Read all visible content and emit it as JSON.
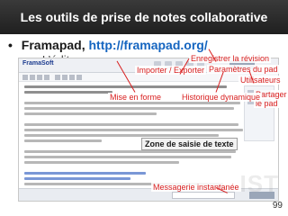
{
  "slide": {
    "title": "Les outils de prise de notes collaborative",
    "bullet_symbol": "•",
    "bullet_label": "Framapad,",
    "bullet_url": "http://framapad.org/",
    "sub_bullet": "– L’éditeur",
    "page_number": "99"
  },
  "pad": {
    "logo_text": "FramaSoft"
  },
  "callouts": {
    "importer_exporter": "Importer / Exporter",
    "enregistrer_revision": "Enregistrer la révision",
    "parametres_pad": "Paramètres du pad",
    "utilisateurs": "Utilisateurs",
    "partager_line1": "Partager",
    "partager_line2": "le pad",
    "mise_en_forme": "Mise en forme",
    "historique_dynamique": "Historique dynamique",
    "zone_saisie": "Zone de saisie de texte",
    "messagerie": "Messagerie instantanée"
  },
  "colors": {
    "title_bar": "#2a2a2a",
    "callout_text": "#d81e1e",
    "url": "#1565c0"
  }
}
